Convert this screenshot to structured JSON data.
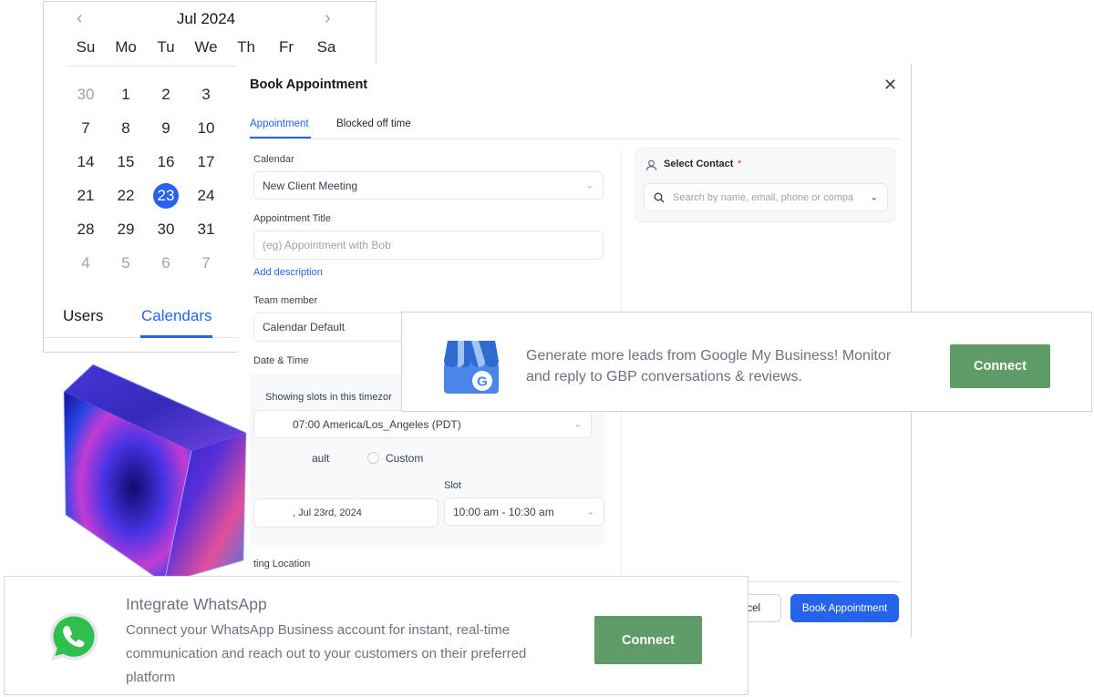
{
  "calendar": {
    "month_label": "Jul 2024",
    "weekdays": [
      "Su",
      "Mo",
      "Tu",
      "We",
      "Th",
      "Fr",
      "Sa"
    ],
    "weeks": [
      [
        "30",
        "1",
        "2",
        "3"
      ],
      [
        "7",
        "8",
        "9",
        "10"
      ],
      [
        "14",
        "15",
        "16",
        "17"
      ],
      [
        "21",
        "22",
        "23",
        "24"
      ],
      [
        "28",
        "29",
        "30",
        "31"
      ],
      [
        "4",
        "5",
        "6",
        "7"
      ]
    ],
    "selected_day": "23",
    "tabs": {
      "users": "Users",
      "calendars": "Calendars"
    }
  },
  "modal": {
    "title": "Book Appointment",
    "tabs": {
      "appointment": "Appointment",
      "blocked": "Blocked off time"
    },
    "calendar_label": "Calendar",
    "calendar_value": "New Client Meeting",
    "title_label": "Appointment Title",
    "title_placeholder": "(eg) Appointment with Bob",
    "add_description": "Add description",
    "team_member_label": "Team member",
    "team_member_value": "Calendar Default",
    "date_time_label": "Date & Time",
    "timezone_label": "Showing slots in this timezor",
    "timezone_value": "07:00 America/Los_Angeles (PDT)",
    "radio_default": "ault",
    "radio_custom": "Custom",
    "slot_label": "Slot",
    "date_value": ", Jul 23rd, 2024",
    "slot_value": "10:00 am - 10:30 am",
    "location_label": "ting Location",
    "contact_label": "Select Contact",
    "contact_required": "*",
    "contact_placeholder": "Search by name, email, phone or compa",
    "cancel_label": "ncel",
    "book_label": "Book Appointment"
  },
  "gbp_banner": {
    "text": "Generate more leads from Google My Business! Monitor and reply to GBP conversations & reviews.",
    "connect_label": "Connect",
    "logo_letter": "G"
  },
  "whatsapp_banner": {
    "title": "Integrate WhatsApp",
    "description": "Connect your WhatsApp Business account for instant, real-time communication and reach out to your customers on their preferred platform",
    "connect_label": "Connect"
  },
  "colors": {
    "accent": "#2563eb",
    "connect_green": "#5e9b66",
    "whatsapp_green": "#25d366",
    "gbp_blue": "#4a86e8"
  }
}
